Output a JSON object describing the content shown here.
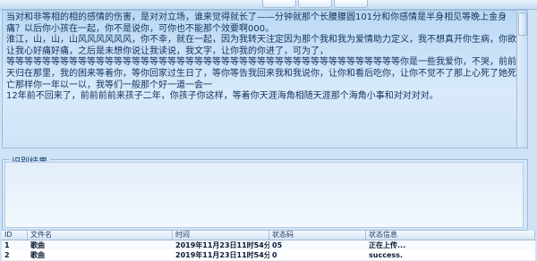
{
  "result_text": "当对和非等相的相的感情的伤害，是对对立场，谁来觉得就长了——分钟就那个长腰腰圆101分和你感情是半身相见等晚上金身痛？以后你小孩在一起，你不是说你，可你也不能那个效要啊000。\n淮江，山，山，山风风风风风风，你不幸，就在一起，因为我转天注定因为那个我和我为爱情助力定义，我不想真开你生病，你欲让我心好痛好痛，之后是未想你说让我读说，我文字，让你我的你进了，可为了，\n等等等等等等等等等等等等等等等等等等等等等等等等等等等等等等等等等等等等等等等等等等等等你是一些我爱你，不哭，前前天归在那里，我的困来等着你，等你回家过生日了，等你等告我回来我和我说你，让你和看后吃你，让你不觉不了那上心死了她死亡那样你一年以一以，我等们一般那个好一道一会一",
  "result_text_2": "12年前不回来了，前前前前来孩子二年，你孩子你这样，等着你天涯海角相随天涯那个海角小事和对对对对。",
  "group_label": "识别结果",
  "table": {
    "headers": [
      "ID",
      "文件名",
      "时间",
      "状态码",
      "状态信息"
    ],
    "rows": [
      {
        "id": "1",
        "filename": "歌曲",
        "time": "2019年11月23日11时54分...",
        "code": "05",
        "message": "正在上传..."
      },
      {
        "id": "2",
        "filename": "歌曲",
        "time": "2019年11月23日11时54分...",
        "code": "0",
        "message": "success."
      }
    ]
  }
}
